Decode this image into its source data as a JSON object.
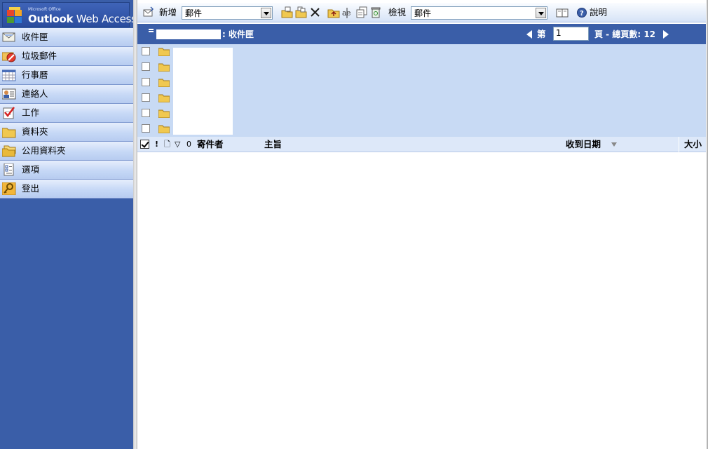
{
  "logo": {
    "small_text": "Microsoft Office",
    "main_bold": "Outlook",
    "main_rest": " Web Access"
  },
  "sidebar": {
    "items": [
      {
        "label": "收件匣",
        "icon": "inbox-icon"
      },
      {
        "label": "垃圾郵件",
        "icon": "junk-mail-icon"
      },
      {
        "label": "行事曆",
        "icon": "calendar-icon"
      },
      {
        "label": "連絡人",
        "icon": "contacts-icon"
      },
      {
        "label": "工作",
        "icon": "tasks-icon"
      },
      {
        "label": "資料夾",
        "icon": "folder-icon"
      },
      {
        "label": "公用資料夾",
        "icon": "public-folders-icon"
      },
      {
        "label": "選項",
        "icon": "options-icon"
      },
      {
        "label": "登出",
        "icon": "logout-key-icon"
      }
    ]
  },
  "toolbar": {
    "new_label": "新增",
    "new_type_value": "郵件",
    "view_label": "檢視",
    "view_value": "郵件",
    "help_label": "說明"
  },
  "folder_header": {
    "title": ": 收件匣",
    "page_prefix": "第",
    "page_value": "1",
    "page_total": "頁 - 總頁數: 12"
  },
  "columns": {
    "importance": "!",
    "type": "🗋",
    "flag": "▽",
    "attachment": "0",
    "from": "寄件者",
    "subject": "主旨",
    "received": "收到日期",
    "size": "大小"
  },
  "colors": {
    "sidebar_bg": "#3a5ea8",
    "nav_item_bg": "#c6d8f6",
    "header_bar_bg": "#3a5ea8",
    "folder_area_bg": "#c8daf4"
  }
}
